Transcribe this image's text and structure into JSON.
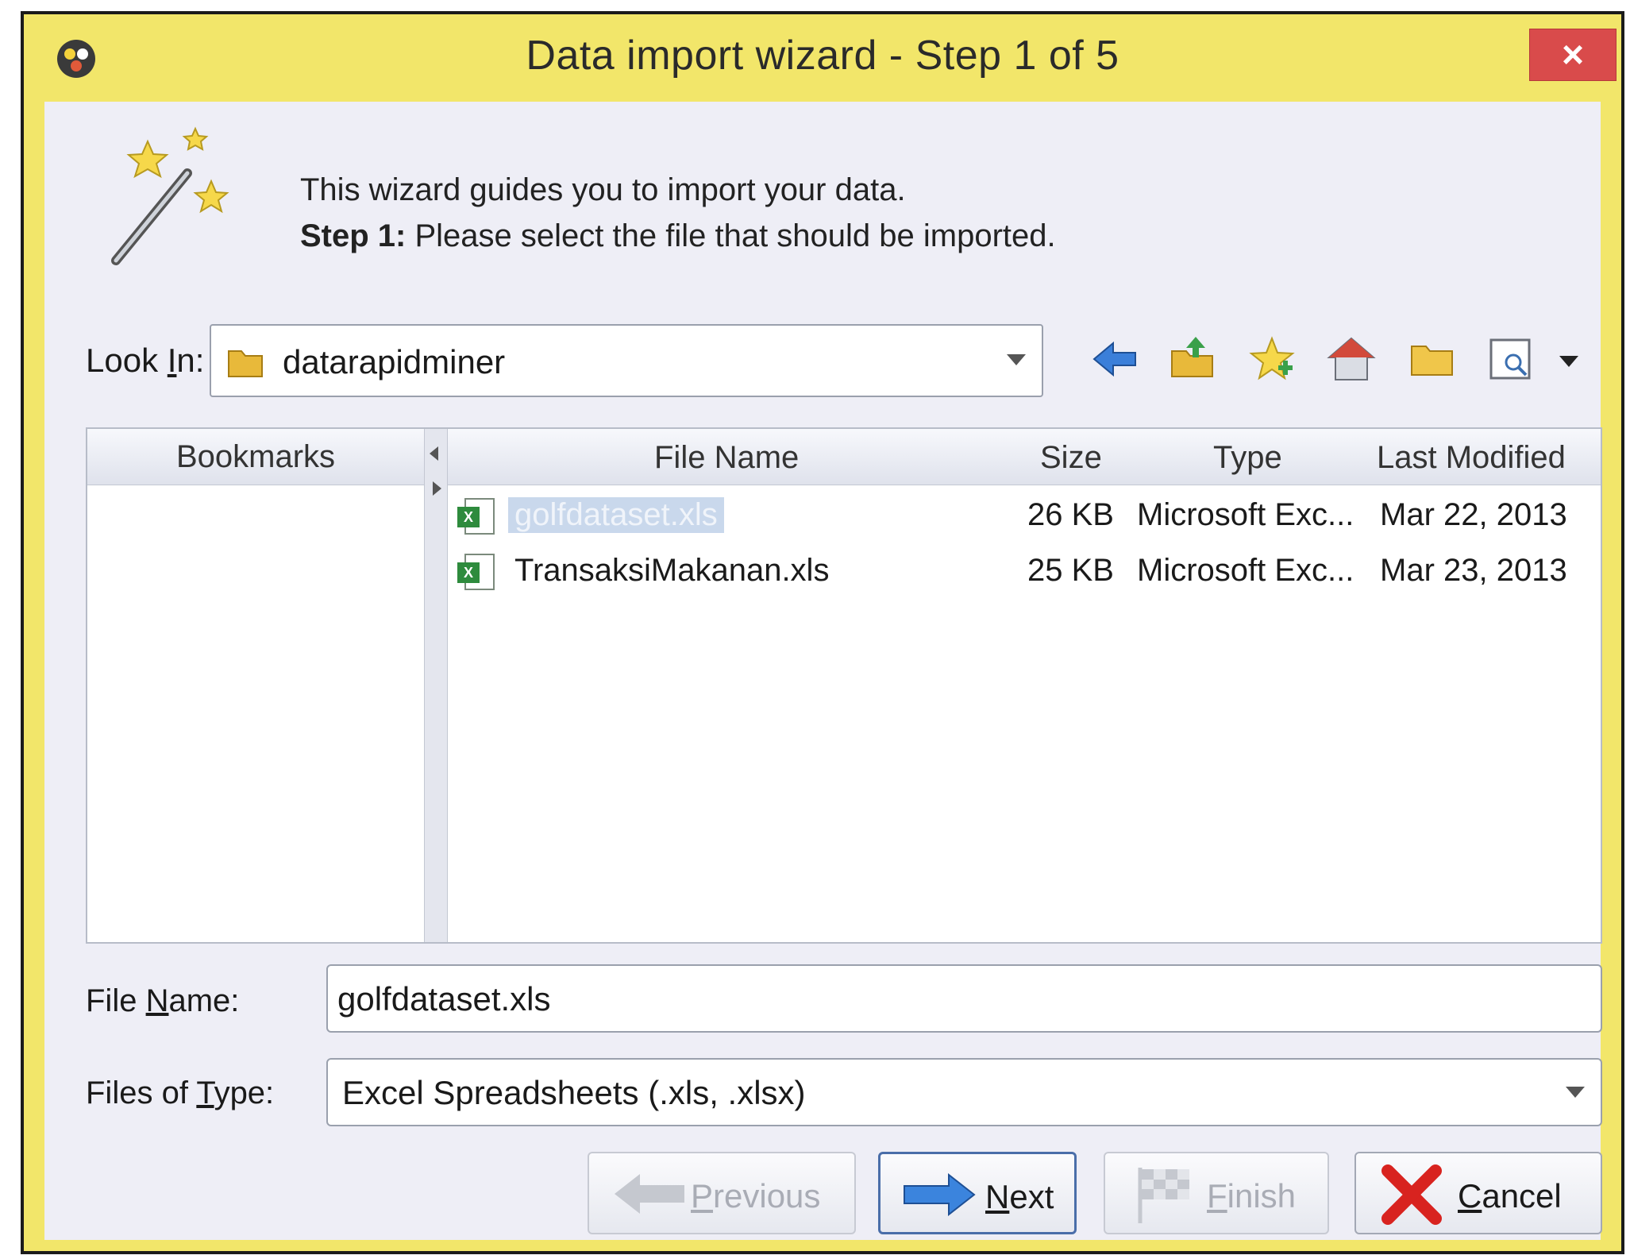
{
  "window": {
    "title": "Data import wizard - Step 1 of 5",
    "close_glyph": "×",
    "app_icon": "rapidminer-logo-icon"
  },
  "intro": {
    "line1": "This wizard guides you to import your data.",
    "step_label": "Step 1:",
    "step_text": " Please select the file that should be imported.",
    "icon": "magic-wand-icon"
  },
  "lookin": {
    "label_pre": "Look ",
    "label_mnemonic": "I",
    "label_post": "n:",
    "value": "datarapidminer",
    "toolbar_icons": [
      "back-arrow-icon",
      "up-folder-icon",
      "bookmark-star-icon",
      "home-icon",
      "new-folder-icon",
      "view-details-icon",
      "view-menu-arrow-icon"
    ]
  },
  "bookmarks": {
    "header": "Bookmarks"
  },
  "filelist": {
    "columns": {
      "name": "File Name",
      "size": "Size",
      "type": "Type",
      "modified": "Last Modified"
    },
    "rows": [
      {
        "name": "golfdataset.xls",
        "size": "26 KB",
        "type": "Microsoft Exc...",
        "modified": "Mar 22, 2013",
        "selected": true
      },
      {
        "name": "TransaksiMakanan.xls",
        "size": "25 KB",
        "type": "Microsoft Exc...",
        "modified": "Mar 23, 2013",
        "selected": false
      }
    ]
  },
  "filename": {
    "label_pre": "File ",
    "label_mnemonic": "N",
    "label_post": "ame:",
    "value": "golfdataset.xls"
  },
  "filetype": {
    "label_pre": "Files of ",
    "label_mnemonic": "T",
    "label_post": "ype:",
    "value": "Excel Spreadsheets (.xls, .xlsx)"
  },
  "buttons": {
    "previous": {
      "mnemonic": "P",
      "rest": "revious"
    },
    "next": {
      "mnemonic": "N",
      "rest": "ext"
    },
    "finish": {
      "mnemonic": "F",
      "rest": "inish"
    },
    "cancel": {
      "mnemonic": "C",
      "rest": "ancel"
    }
  },
  "colors": {
    "frame": "#f2e66a",
    "content": "#eeeef6",
    "close": "#d94b4b",
    "selection": "#c9d8ec"
  }
}
